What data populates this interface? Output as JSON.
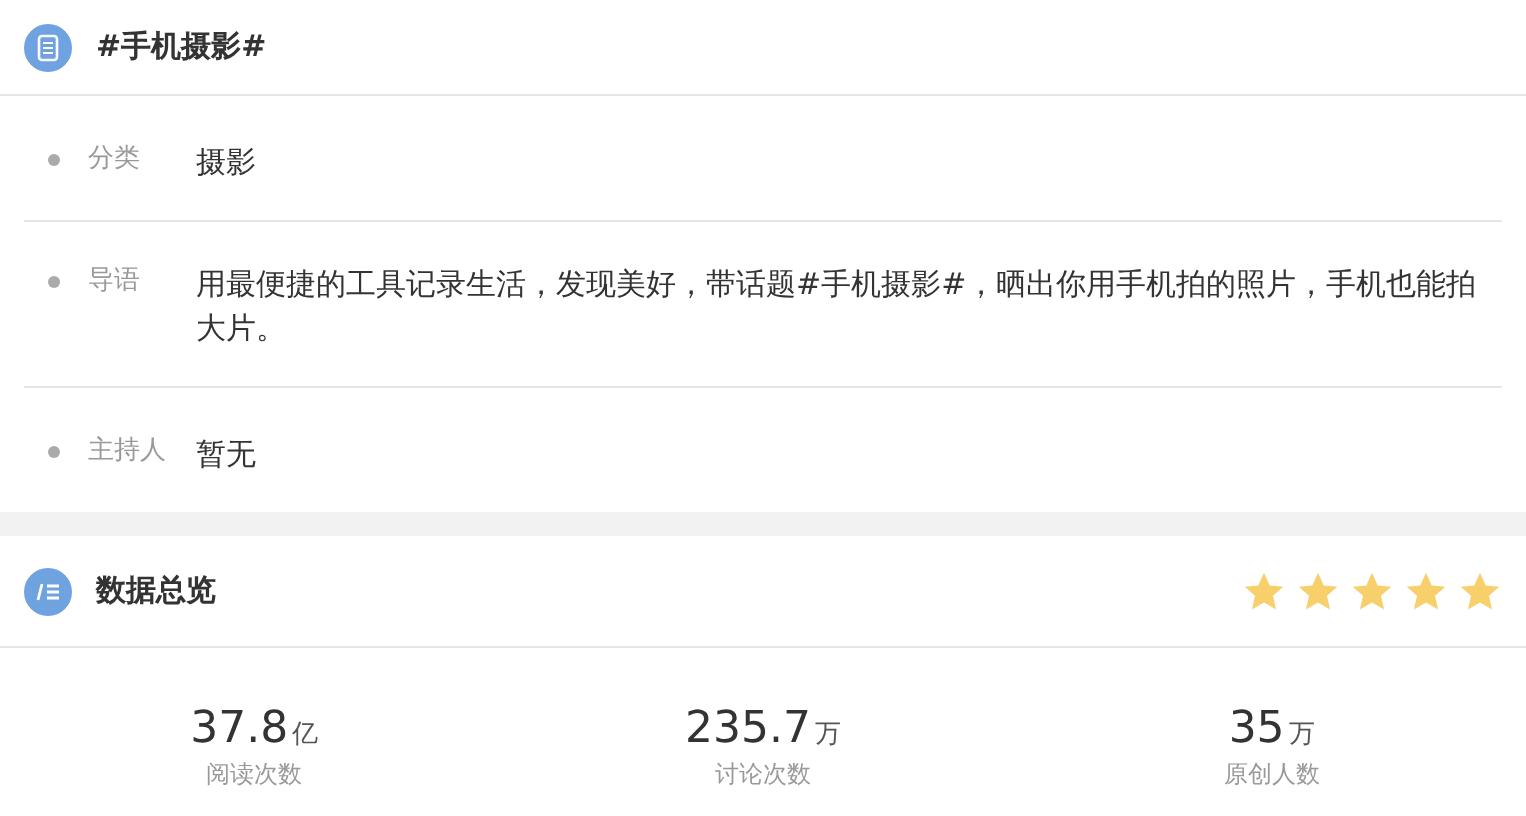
{
  "topic": {
    "title": "#手机摄影#"
  },
  "details": [
    {
      "label": "分类",
      "value": "摄影"
    },
    {
      "label": "导语",
      "value": "用最便捷的工具记录生活，发现美好，带话题#手机摄影#，晒出你用手机拍的照片，手机也能拍大片。"
    },
    {
      "label": "主持人",
      "value": "暂无"
    }
  ],
  "overview": {
    "title": "数据总览",
    "stars": 5
  },
  "stats": [
    {
      "number": "37.8",
      "unit": "亿",
      "label": "阅读次数"
    },
    {
      "number": "235.7",
      "unit": "万",
      "label": "讨论次数"
    },
    {
      "number": "35",
      "unit": "万",
      "label": "原创人数"
    }
  ]
}
